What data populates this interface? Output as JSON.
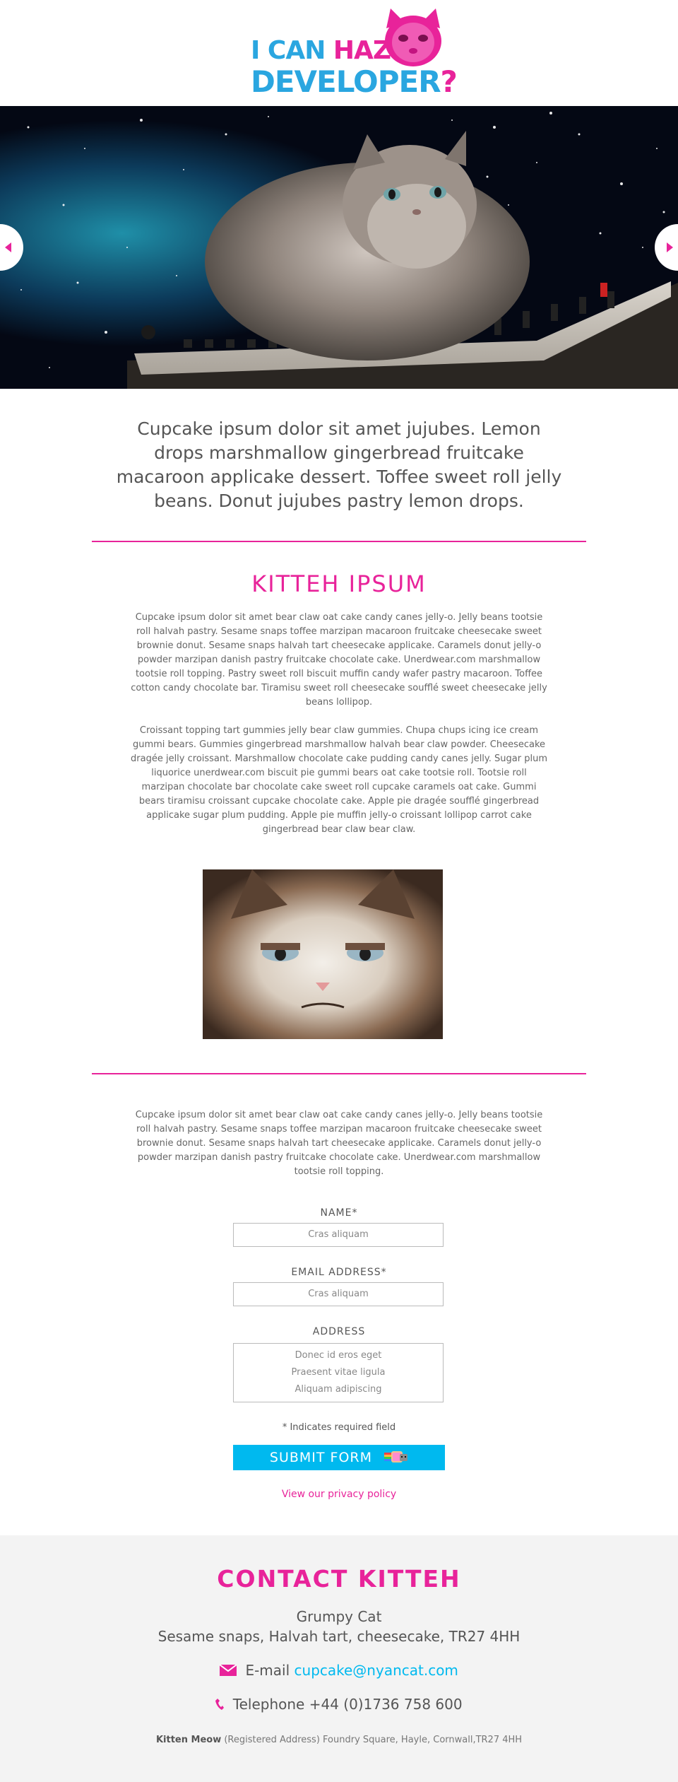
{
  "header": {
    "logo_line1_a": "I CAN ",
    "logo_line1_b": "HAZ",
    "logo_line2_a": "DEVELOPER",
    "logo_line2_b": "?"
  },
  "hero": {
    "prev_icon": "chevron-left-icon",
    "next_icon": "chevron-right-icon"
  },
  "intro": {
    "text": "Cupcake ipsum dolor sit amet jujubes. Lemon drops marshmallow gingerbread fruitcake macaroon applicake dessert. Toffee sweet roll jelly beans. Donut jujubes pastry lemon drops."
  },
  "section1": {
    "title": "KITTEH IPSUM",
    "para1": "Cupcake ipsum dolor sit amet bear claw oat cake candy canes jelly-o. Jelly beans tootsie roll halvah pastry. Sesame snaps toffee marzipan macaroon fruitcake cheesecake sweet brownie donut. Sesame snaps halvah tart cheesecake applicake. Caramels donut jelly-o powder marzipan danish pastry fruitcake chocolate cake. Unerdwear.com marshmallow tootsie roll topping. Pastry sweet roll biscuit muffin candy wafer pastry macaroon. Toffee cotton candy chocolate bar. Tiramisu sweet roll cheesecake soufflé sweet cheesecake jelly beans lollipop.",
    "para2": "Croissant topping tart gummies jelly bear claw gummies. Chupa chups icing ice cream gummi bears. Gummies gingerbread marshmallow halvah bear claw powder. Cheesecake dragée jelly croissant. Marshmallow chocolate cake pudding candy canes jelly. Sugar plum liquorice unerdwear.com biscuit pie gummi bears oat cake tootsie roll. Tootsie roll marzipan chocolate bar chocolate cake sweet roll cupcake caramels oat cake. Gummi bears tiramisu croissant cupcake chocolate cake. Apple pie dragée soufflé gingerbread applicake sugar plum pudding. Apple pie muffin jelly-o croissant lollipop carrot cake gingerbread bear claw bear claw."
  },
  "section2": {
    "para": "Cupcake ipsum dolor sit amet bear claw oat cake candy canes jelly-o. Jelly beans tootsie roll halvah pastry. Sesame snaps toffee marzipan macaroon fruitcake cheesecake sweet brownie donut. Sesame snaps halvah tart cheesecake applicake. Caramels donut jelly-o powder marzipan danish pastry fruitcake chocolate cake. Unerdwear.com marshmallow tootsie roll topping."
  },
  "form": {
    "name_label": "NAME*",
    "name_value": "Cras aliquam",
    "email_label": "EMAIL ADDRESS*",
    "email_value": "Cras aliquam",
    "address_label": "ADDRESS",
    "address_line1": "Donec id eros eget",
    "address_line2": "Praesent vitae ligula",
    "address_line3": "Aliquam adipiscing",
    "required_note": "* Indicates required field",
    "submit_label": "SUBMIT FORM",
    "privacy_link": "View our privacy policy"
  },
  "footer": {
    "title": "CONTACT KITTEH",
    "name": "Grumpy Cat",
    "address": "Sesame snaps, Halvah tart, cheesecake, TR27 4HH",
    "email_label": "E-mail",
    "email_value": "cupcake@nyancat.com",
    "tel_label": "Telephone",
    "tel_value": "+44 (0)1736 758 600",
    "reg_name": "Kitten Meow",
    "reg_text": "(Registered Address) Foundry Square, Hayle, Cornwall,TR27 4HH"
  },
  "colors": {
    "accent_pink": "#e8239a",
    "accent_blue": "#00b9ef"
  }
}
